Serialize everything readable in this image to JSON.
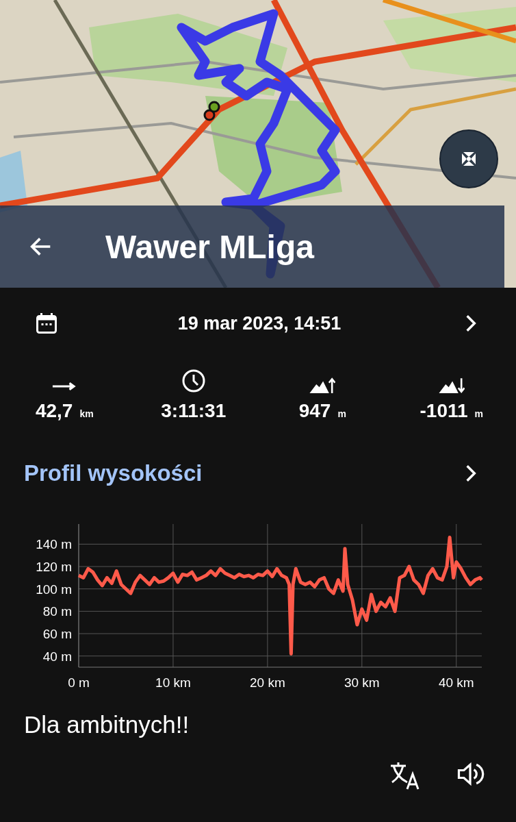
{
  "toolbar": {
    "title": "Wawer MLiga"
  },
  "date": "19 mar 2023, 14:51",
  "stats": [
    {
      "kind": "distance",
      "value": "42,7",
      "unit": "km"
    },
    {
      "kind": "duration",
      "value": "3:11:31"
    },
    {
      "kind": "ascent",
      "value": "947",
      "unit": "m"
    },
    {
      "kind": "descent",
      "value": "-1011",
      "unit": "m"
    }
  ],
  "elevation": {
    "title": "Profil wysokości",
    "chart_data": {
      "type": "line",
      "grid": true,
      "xlim": [
        0,
        42.7
      ],
      "ylim": [
        30,
        158
      ],
      "xticks": [
        {
          "value": 0,
          "label": "0 m"
        },
        {
          "value": 10,
          "label": "10 km"
        },
        {
          "value": 20,
          "label": "20 km"
        },
        {
          "value": 30,
          "label": "30 km"
        },
        {
          "value": 40,
          "label": "40 km"
        }
      ],
      "yticks": [
        {
          "value": 40,
          "label": "40 m"
        },
        {
          "value": 60,
          "label": "60 m"
        },
        {
          "value": 80,
          "label": "80 m"
        },
        {
          "value": 100,
          "label": "100 m"
        },
        {
          "value": 120,
          "label": "120 m"
        },
        {
          "value": 140,
          "label": "140 m"
        }
      ],
      "x": [
        0,
        0.5,
        1,
        1.5,
        2,
        2.5,
        3,
        3.5,
        4,
        4.5,
        5,
        5.5,
        6,
        6.5,
        7,
        7.5,
        8,
        8.5,
        9,
        9.5,
        10,
        10.5,
        11,
        11.5,
        12,
        12.5,
        13,
        13.5,
        14,
        14.5,
        15,
        15.5,
        16,
        16.5,
        17,
        17.5,
        18,
        18.5,
        19,
        19.5,
        20,
        20.5,
        21,
        21.5,
        22,
        22.3,
        22.5,
        22.7,
        23,
        23.5,
        24,
        24.5,
        25,
        25.5,
        26,
        26.5,
        27,
        27.5,
        28,
        28.2,
        28.5,
        29,
        29.5,
        30,
        30.5,
        31,
        31.5,
        32,
        32.5,
        33,
        33.5,
        34,
        34.5,
        35,
        35.5,
        36,
        36.5,
        37,
        37.5,
        38,
        38.5,
        39,
        39.3,
        39.7,
        40,
        40.5,
        41,
        41.5,
        42,
        42.5,
        42.7
      ],
      "series": [
        {
          "color": "#ff5a4a",
          "values": [
            112,
            110,
            118,
            115,
            108,
            103,
            110,
            105,
            116,
            104,
            100,
            96,
            106,
            112,
            108,
            104,
            110,
            106,
            107,
            110,
            114,
            106,
            113,
            112,
            115,
            108,
            110,
            112,
            116,
            112,
            118,
            114,
            112,
            110,
            113,
            111,
            112,
            110,
            113,
            112,
            116,
            111,
            118,
            112,
            110,
            104,
            42,
            104,
            118,
            106,
            104,
            106,
            102,
            108,
            110,
            100,
            96,
            108,
            98,
            136,
            104,
            90,
            68,
            82,
            72,
            95,
            80,
            88,
            84,
            92,
            80,
            110,
            112,
            120,
            108,
            104,
            96,
            112,
            118,
            110,
            108,
            120,
            146,
            110,
            124,
            118,
            110,
            104,
            108,
            110,
            108
          ]
        }
      ]
    }
  },
  "description": "Dla ambitnych!!"
}
